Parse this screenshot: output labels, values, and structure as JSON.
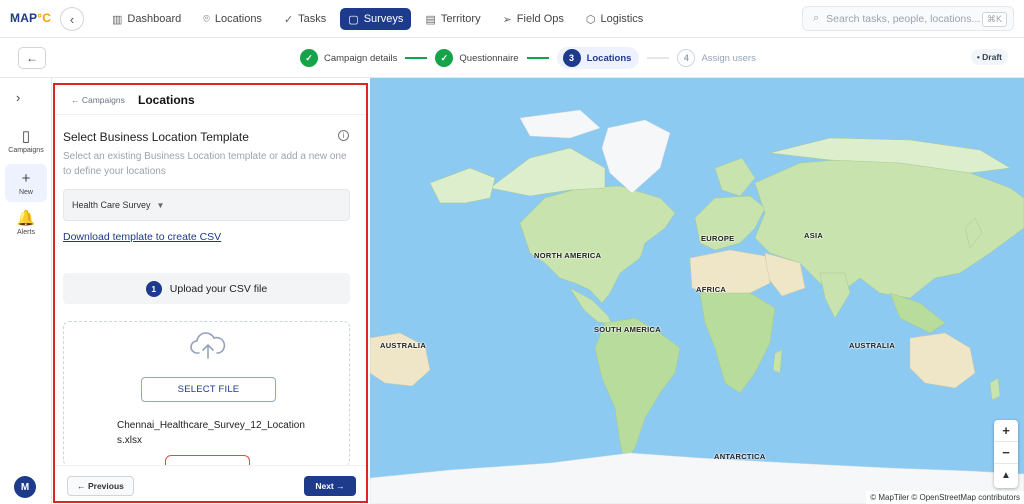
{
  "app": {
    "logo_text": "MAP",
    "logo_accent": "°C"
  },
  "nav": [
    {
      "label": "Dashboard",
      "icon": "bar-chart-icon",
      "glyph": "▥"
    },
    {
      "label": "Locations",
      "icon": "pin-icon",
      "glyph": "⌾"
    },
    {
      "label": "Tasks",
      "icon": "check-icon",
      "glyph": "✓"
    },
    {
      "label": "Surveys",
      "icon": "clipboard-icon",
      "glyph": "▢",
      "active": true
    },
    {
      "label": "Territory",
      "icon": "map-icon",
      "glyph": "▤"
    },
    {
      "label": "Field Ops",
      "icon": "send-icon",
      "glyph": "➢"
    },
    {
      "label": "Logistics",
      "icon": "box-icon",
      "glyph": "⬡"
    }
  ],
  "search": {
    "placeholder": "Search tasks, people, locations...",
    "shortcut": "⌘K"
  },
  "stepper": {
    "steps": [
      {
        "label": "Campaign details",
        "state": "done",
        "marker": "✓"
      },
      {
        "label": "Questionnaire",
        "state": "done",
        "marker": "✓"
      },
      {
        "label": "Locations",
        "state": "current",
        "marker": "3"
      },
      {
        "label": "Assign users",
        "state": "todo",
        "marker": "4"
      }
    ],
    "status_badge": "• Draft"
  },
  "rail": {
    "items": [
      {
        "label": "Campaigns",
        "glyph": "▯",
        "icon": "clipboard-icon"
      },
      {
        "label": "New",
        "glyph": "+",
        "icon": "plus-icon",
        "active": true
      },
      {
        "label": "Alerts",
        "glyph": "🔔",
        "icon": "bell-icon"
      }
    ],
    "avatar_initial": "M"
  },
  "panel": {
    "breadcrumb": "← Campaigns",
    "title": "Locations",
    "section_title": "Select Business Location Template",
    "section_desc": "Select an existing Business Location template or add a new one to define your locations",
    "template_selected": "Health Care Survey",
    "download_link": "Download template to create CSV",
    "upload_step": "1",
    "upload_label": "Upload your CSV file",
    "select_file_button": "SELECT FILE",
    "file_name": "Chennai_Healthcare_Survey_12_Locations.xlsx",
    "prev_button": "← Previous",
    "next_button": "Next →"
  },
  "map": {
    "labels": {
      "north_america": "NORTH AMERICA",
      "south_america": "SOUTH AMERICA",
      "europe": "EUROPE",
      "asia": "ASIA",
      "africa": "AFRICA",
      "australia_left": "AUSTRALIA",
      "australia_right": "AUSTRALIA",
      "antarctica": "ANTARCTICA"
    },
    "zoom_in": "+",
    "zoom_out": "−",
    "compass": "▲",
    "attribution": "© MapTiler © OpenStreetMap contributors",
    "colors": {
      "ocean": "#8ccaf2",
      "land": "#c8e3ad",
      "ice": "#f5f7f8",
      "desert": "#efe6c8"
    }
  }
}
